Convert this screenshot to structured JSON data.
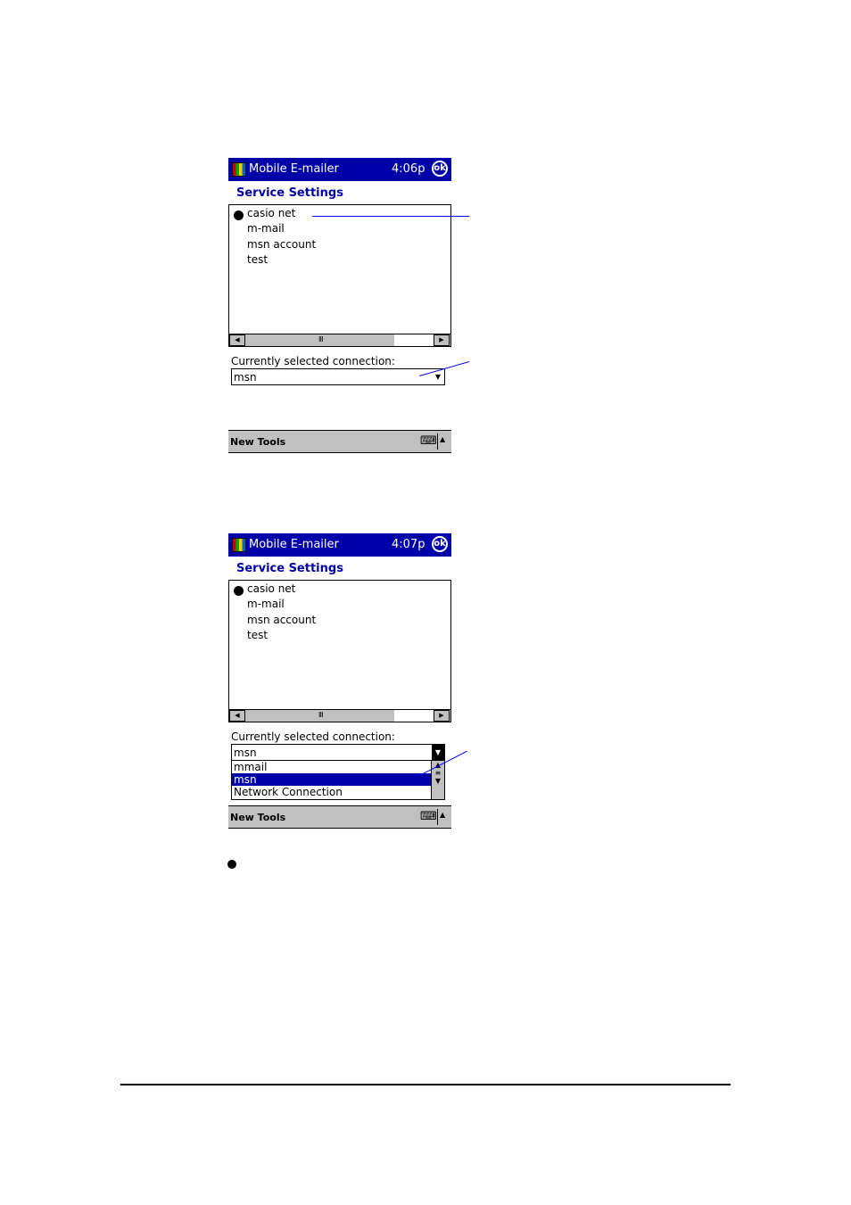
{
  "screens": [
    {
      "app_title": "Mobile E-mailer",
      "time": "4:06p",
      "ok_label": "ok",
      "section_title": "Service Settings",
      "services": [
        "casio net",
        "m-mail",
        "msn account",
        "test"
      ],
      "selected_service": "casio net",
      "connection_label": "Currently selected connection:",
      "connection_value": "msn",
      "menu": "New Tools"
    },
    {
      "app_title": "Mobile E-mailer",
      "time": "4:07p",
      "ok_label": "ok",
      "section_title": "Service Settings",
      "services": [
        "casio net",
        "m-mail",
        "msn account",
        "test"
      ],
      "selected_service": "casio net",
      "connection_label": "Currently selected connection:",
      "connection_value": "msn",
      "dropdown_options": [
        "mmail",
        "msn",
        "Network Connection"
      ],
      "dropdown_selected": "msn",
      "menu": "New Tools"
    }
  ],
  "colors": {
    "titlebar": "#0000a8",
    "accent": "#0000a8",
    "callout": "#0000ff"
  }
}
